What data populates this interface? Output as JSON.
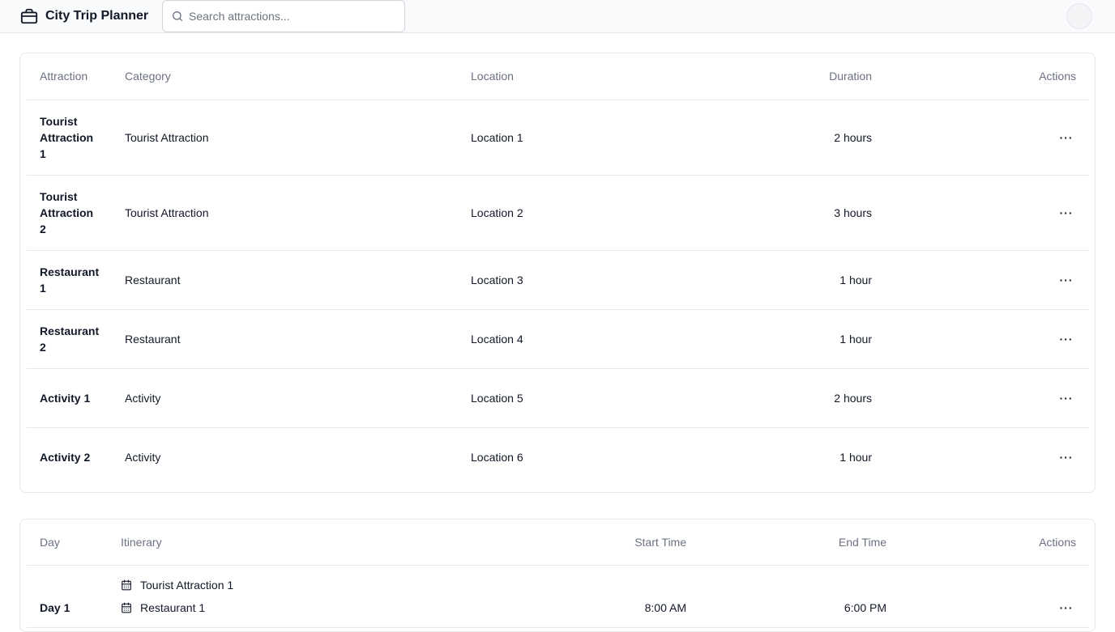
{
  "header": {
    "title": "City Trip Planner",
    "search_placeholder": "Search attractions...",
    "search_value": ""
  },
  "attractions": {
    "columns": [
      "Attraction",
      "Category",
      "Location",
      "Duration",
      "Actions"
    ],
    "rows": [
      {
        "name": "Tourist Attraction 1",
        "category": "Tourist Attraction",
        "location": "Location 1",
        "duration": "2 hours",
        "actions": "···"
      },
      {
        "name": "Tourist Attraction 2",
        "category": "Tourist Attraction",
        "location": "Location 2",
        "duration": "3 hours",
        "actions": "···"
      },
      {
        "name": "Restaurant 1",
        "category": "Restaurant",
        "location": "Location 3",
        "duration": "1 hour",
        "actions": "···"
      },
      {
        "name": "Restaurant 2",
        "category": "Restaurant",
        "location": "Location 4",
        "duration": "1 hour",
        "actions": "···"
      },
      {
        "name": "Activity 1",
        "category": "Activity",
        "location": "Location 5",
        "duration": "2 hours",
        "actions": "···"
      },
      {
        "name": "Activity 2",
        "category": "Activity",
        "location": "Location 6",
        "duration": "1 hour",
        "actions": "···"
      }
    ]
  },
  "itinerary": {
    "columns": [
      "Day",
      "Itinerary",
      "Start Time",
      "End Time",
      "Actions"
    ],
    "rows": [
      {
        "day": "Day 1",
        "items": [
          "Tourist Attraction 1",
          "Restaurant 1"
        ],
        "start": "8:00 AM",
        "end": "6:00 PM",
        "actions": "···"
      }
    ]
  },
  "colors": {
    "border": "#e5e7eb",
    "muted_text": "#6b7280",
    "text": "#111827",
    "topbar_bg": "#f9fafb"
  },
  "icons": {
    "brand": "suitcase-icon",
    "search": "search-icon",
    "itinerary_item": "calendar-icon",
    "actions": "more-horizontal-icon"
  }
}
